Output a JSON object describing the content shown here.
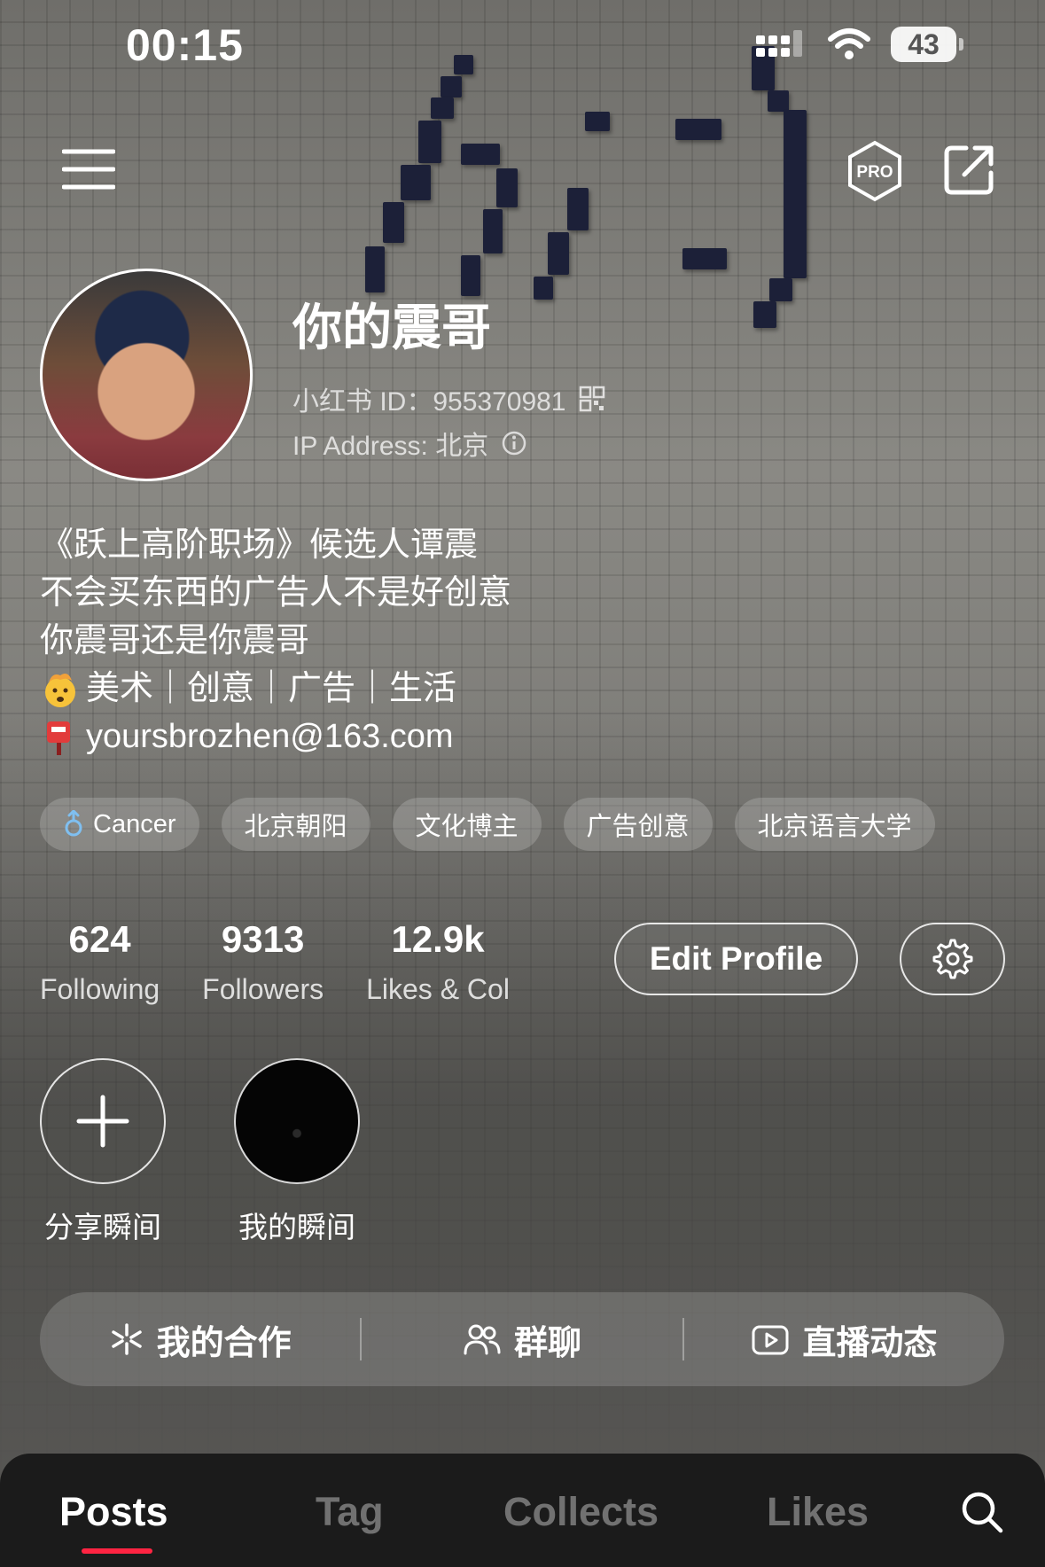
{
  "status_bar": {
    "time": "00:15",
    "battery": "43",
    "icons": [
      "cellular-signal-icon",
      "wifi-icon",
      "battery-icon"
    ]
  },
  "header": {
    "icons": [
      "menu-icon",
      "pro-badge-icon",
      "share-icon"
    ],
    "pro_label": "PRO"
  },
  "profile": {
    "nickname": "你的震哥",
    "id_text": "小红书 ID：955370981",
    "ip_text": "IP Address: 北京"
  },
  "bio": {
    "line1": "《跃上高阶职场》候选人谭震",
    "line2": "不会买东西的广告人不是好创意",
    "line3": "你震哥还是你震哥",
    "line4": "美术｜创意｜广告｜生活",
    "line5": "yoursbrozhen@163.com"
  },
  "tags": [
    {
      "label": "Cancer"
    },
    {
      "label": "北京朝阳"
    },
    {
      "label": "文化博主"
    },
    {
      "label": "广告创意"
    },
    {
      "label": "北京语言大学"
    }
  ],
  "stats": [
    {
      "value": "624",
      "label": "Following"
    },
    {
      "value": "9313",
      "label": "Followers"
    },
    {
      "value": "12.9k",
      "label": "Likes & Col"
    }
  ],
  "buttons": {
    "edit_profile": "Edit Profile"
  },
  "moments": [
    {
      "label": "分享瞬间"
    },
    {
      "label": "我的瞬间"
    }
  ],
  "actions": [
    {
      "label": "我的合作"
    },
    {
      "label": "群聊"
    },
    {
      "label": "直播动态"
    }
  ],
  "tabs": [
    {
      "label": "Posts"
    },
    {
      "label": "Tag"
    },
    {
      "label": "Collects"
    },
    {
      "label": "Likes"
    }
  ],
  "colors": {
    "accent": "#ff2442",
    "tabbar": "#1b1b1b"
  }
}
